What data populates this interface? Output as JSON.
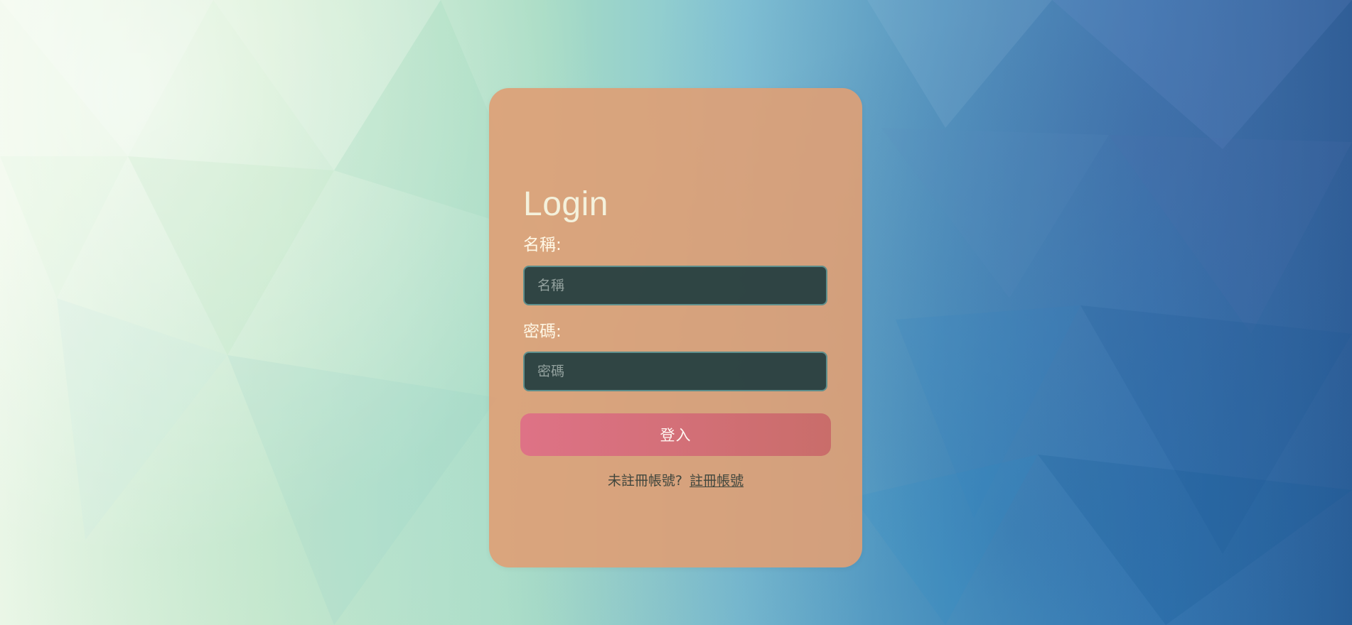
{
  "page": {
    "title": "Login"
  },
  "form": {
    "name_label": "名稱:",
    "name_placeholder": "名稱",
    "password_label": "密碼:",
    "password_placeholder": "密碼",
    "submit_label": "登入"
  },
  "register": {
    "prompt": "未註冊帳號?",
    "link_text": "註冊帳號"
  },
  "colors": {
    "card_background": "#dda076",
    "input_background": "#223d40",
    "button_gradient_start": "#de7286",
    "button_gradient_end": "#c96d6a",
    "title_color": "#f4f1dc"
  }
}
